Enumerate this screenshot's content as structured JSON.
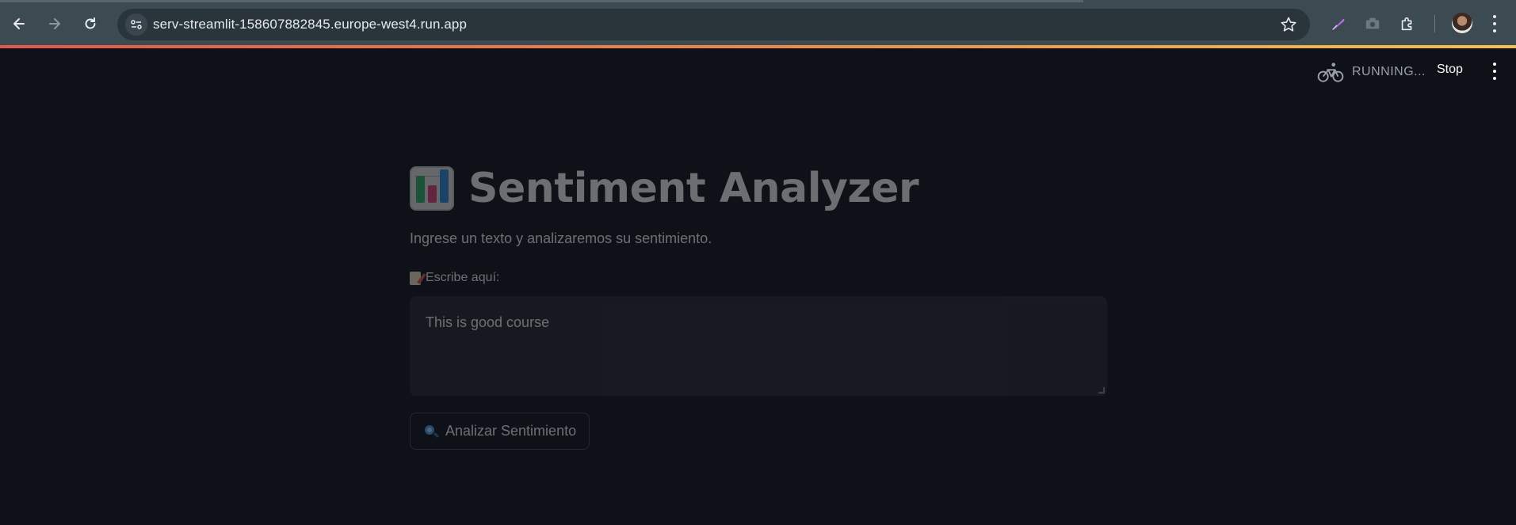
{
  "browser": {
    "url": "serv-streamlit-158607882845.europe-west4.run.app",
    "icons": [
      "back-icon",
      "forward-icon",
      "reload-icon",
      "site-info-icon",
      "bookmark-star-icon",
      "feather-extension-icon",
      "camera-extension-icon",
      "extensions-puzzle-icon",
      "profile-avatar",
      "chrome-menu-icon"
    ]
  },
  "streamlit_header": {
    "status_label": "RUNNING...",
    "stop_label": "Stop"
  },
  "app": {
    "title": "Sentiment Analyzer",
    "subtitle": "Ingrese un texto y analizaremos su sentimiento.",
    "input_label": "Escribe aquí:",
    "input_value": "This is good course",
    "button_label": "Analizar Sentimiento"
  },
  "colors": {
    "background": "#0e1117",
    "chrome": "#3c4a52",
    "omnibox": "#2a353b",
    "textarea_bg": "#262730",
    "text": "#fafafa"
  }
}
